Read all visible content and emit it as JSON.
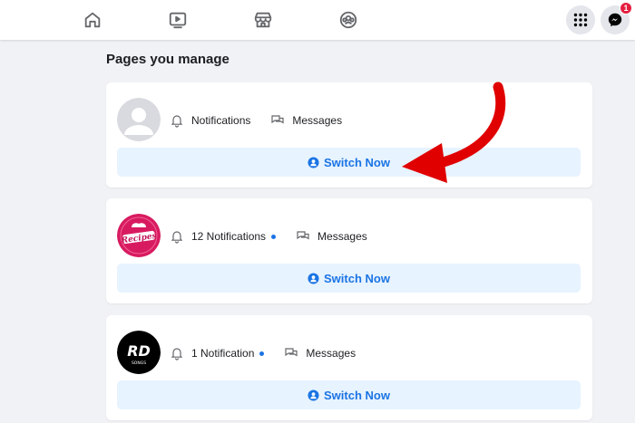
{
  "nav": {
    "icons": [
      "home-icon",
      "watch-icon",
      "marketplace-icon",
      "groups-icon"
    ],
    "menu_icon": "grid-menu-icon",
    "messenger_icon": "messenger-icon",
    "messenger_badge": "1"
  },
  "section": {
    "title": "Pages you manage"
  },
  "pages": [
    {
      "avatar_text": "",
      "notifications": "Notifications",
      "has_dot": false,
      "messages": "Messages",
      "switch_label": "Switch Now"
    },
    {
      "avatar_text": "Recipes",
      "notifications": "12 Notifications",
      "has_dot": true,
      "messages": "Messages",
      "switch_label": "Switch Now"
    },
    {
      "avatar_text": "RD",
      "avatar_subtext": "SONGS",
      "notifications": "1 Notification",
      "has_dot": true,
      "messages": "Messages",
      "switch_label": "Switch Now"
    }
  ],
  "colors": {
    "accent": "#1b74e4",
    "button_bg": "#e7f3ff",
    "arrow": "#e00000",
    "badge": "#e41e3f"
  }
}
